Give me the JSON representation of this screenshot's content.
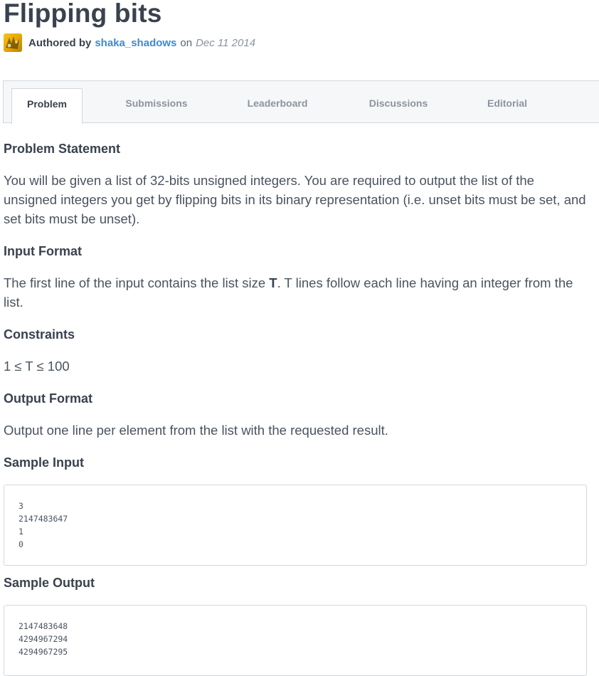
{
  "problem": {
    "title": "Flipping bits",
    "author_prefix": "Authored by",
    "author": "shaka_shadows",
    "on_word": "on",
    "date": "Dec 11 2014"
  },
  "tabs": [
    {
      "label": "Problem",
      "active": true
    },
    {
      "label": "Submissions",
      "active": false
    },
    {
      "label": "Leaderboard",
      "active": false
    },
    {
      "label": "Discussions",
      "active": false
    },
    {
      "label": "Editorial",
      "active": false
    }
  ],
  "sections": {
    "statement_heading": "Problem Statement",
    "statement_text": "You will be given a list of 32-bits unsigned integers. You are required to output the list of the unsigned integers you get by flipping bits in its binary representation (i.e. unset bits must be set, and set bits must be unset).",
    "input_heading": "Input Format",
    "input_text_before": "The first line of the input contains the list size ",
    "input_text_bold": "T",
    "input_text_after": ". T lines follow each line having an integer from the list.",
    "constraints_heading": "Constraints",
    "constraints_text": "1 ≤ T ≤ 100",
    "output_heading": "Output Format",
    "output_text": "Output one line per element from the list with the requested result.",
    "sample_input_heading": "Sample Input",
    "sample_input_lines": [
      "3",
      "2147483647",
      "1",
      "0"
    ],
    "sample_output_heading": "Sample Output",
    "sample_output_lines": [
      "2147483648",
      "4294967294",
      "4294967295"
    ]
  },
  "colors": {
    "heading": "#39424e",
    "link": "#3c8ad8",
    "muted": "#8c949f",
    "border": "#d3d7dc",
    "tab_bar_bg": "#f6f7f9"
  }
}
